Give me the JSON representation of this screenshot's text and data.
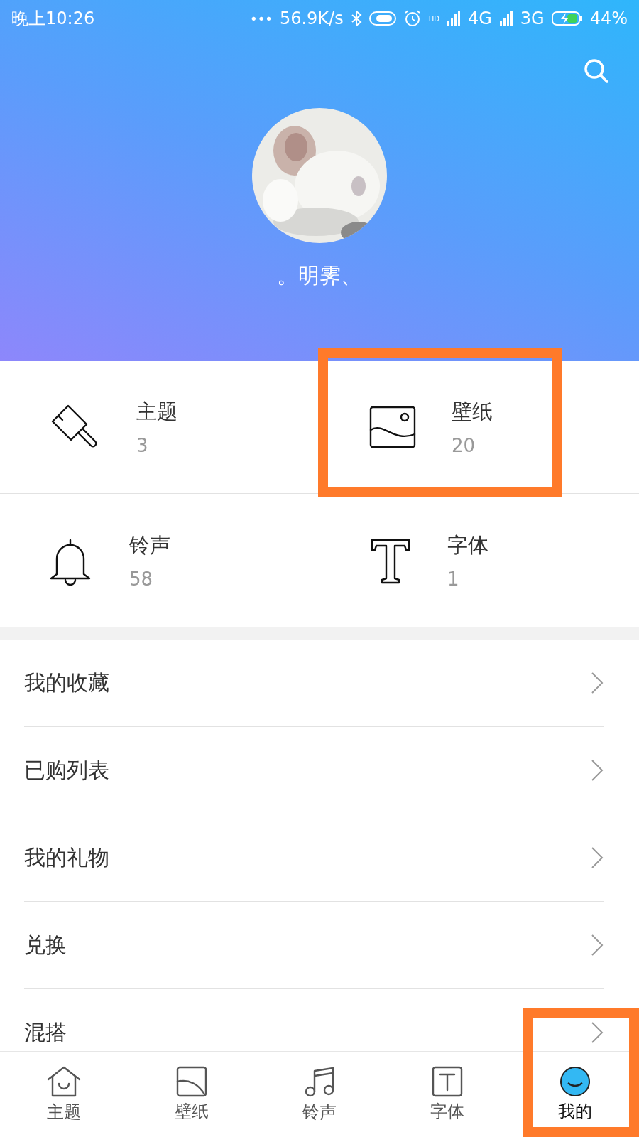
{
  "status_bar": {
    "time": "晚上10:26",
    "dots": "•••",
    "speed": "56.9K/s",
    "hd": "HD",
    "network_1": "4G",
    "network_2": "3G",
    "battery": "44%"
  },
  "profile": {
    "name": "。明霁、"
  },
  "categories": [
    {
      "kind": "theme",
      "label": "主题",
      "count": "3",
      "highlighted": false
    },
    {
      "kind": "wallpaper",
      "label": "壁纸",
      "count": "20",
      "highlighted": true
    },
    {
      "kind": "ringtone",
      "label": "铃声",
      "count": "58",
      "highlighted": false
    },
    {
      "kind": "font",
      "label": "字体",
      "count": "1",
      "highlighted": false
    }
  ],
  "menu": [
    {
      "label": "我的收藏"
    },
    {
      "label": "已购列表"
    },
    {
      "label": "我的礼物"
    },
    {
      "label": "兑换"
    },
    {
      "label": "混搭"
    }
  ],
  "bottom_nav": [
    {
      "kind": "theme",
      "label": "主题",
      "selected": false,
      "highlighted": false
    },
    {
      "kind": "wallpaper",
      "label": "壁纸",
      "selected": false,
      "highlighted": false
    },
    {
      "kind": "ringtone",
      "label": "铃声",
      "selected": false,
      "highlighted": false
    },
    {
      "kind": "font",
      "label": "字体",
      "selected": false,
      "highlighted": false
    },
    {
      "kind": "mine",
      "label": "我的",
      "selected": true,
      "highlighted": true
    }
  ]
}
